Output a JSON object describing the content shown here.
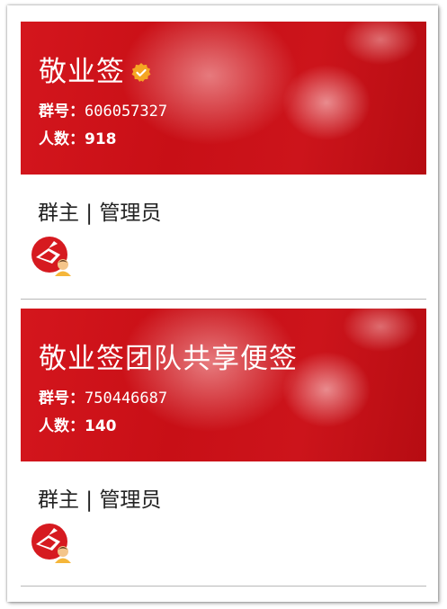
{
  "groups": [
    {
      "name": "敬业签",
      "verified": true,
      "id_label": "群号：",
      "id": "606057327",
      "members_label": "人数：",
      "members": "918",
      "roles": "群主 | 管理员",
      "avatar_icon": "owner-avatar-icon"
    },
    {
      "name": "敬业签团队共享便签",
      "verified": false,
      "id_label": "群号：",
      "id": "750446687",
      "members_label": "人数：",
      "members": "140",
      "roles": "群主 | 管理员",
      "avatar_icon": "owner-avatar-icon"
    }
  ],
  "colors": {
    "banner_red": "#cc141b",
    "verified_badge": "#f5a623",
    "text_dark": "#222222"
  }
}
